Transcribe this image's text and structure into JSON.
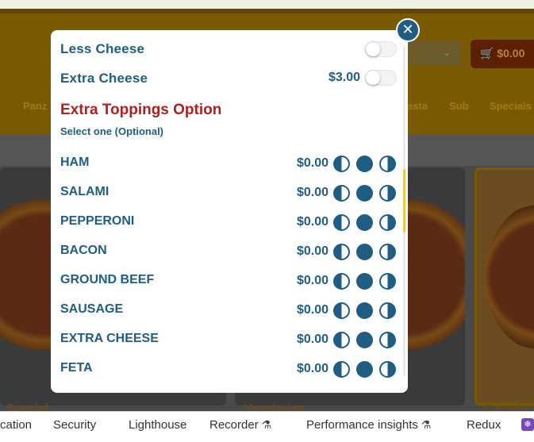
{
  "background": {
    "cart_total": "$0.00",
    "nav_items": [
      "Panz",
      "asta",
      "Sub",
      "Specials"
    ],
    "card_captions": [
      "Special",
      "Vegetarian",
      "Canadian"
    ]
  },
  "modal": {
    "options": [
      {
        "label": "Less Cheese",
        "price": "",
        "checked": false
      },
      {
        "label": "Extra Cheese",
        "price": "$3.00",
        "checked": false
      }
    ],
    "section": {
      "title": "Extra Toppings Option",
      "subtitle": "Select one (Optional)"
    },
    "toppings": [
      {
        "name": "HAM",
        "price": "$0.00"
      },
      {
        "name": "SALAMI",
        "price": "$0.00"
      },
      {
        "name": "PEPPERONI",
        "price": "$0.00"
      },
      {
        "name": "BACON",
        "price": "$0.00"
      },
      {
        "name": "GROUND BEEF",
        "price": "$0.00"
      },
      {
        "name": "SAUSAGE",
        "price": "$0.00"
      },
      {
        "name": "EXTRA CHEESE",
        "price": "$0.00"
      },
      {
        "name": "FETA",
        "price": "$0.00"
      }
    ],
    "colors": {
      "accent": "#1f5d82",
      "section_title": "#b02020"
    }
  },
  "devtools": {
    "tabs": [
      {
        "label": "cation",
        "experimental": false
      },
      {
        "label": "Security",
        "experimental": false
      },
      {
        "label": "Lighthouse",
        "experimental": false
      },
      {
        "label": "Recorder",
        "experimental": true
      },
      {
        "label": "Performance insights",
        "experimental": true
      },
      {
        "label": "Redux",
        "experimental": false
      }
    ]
  }
}
